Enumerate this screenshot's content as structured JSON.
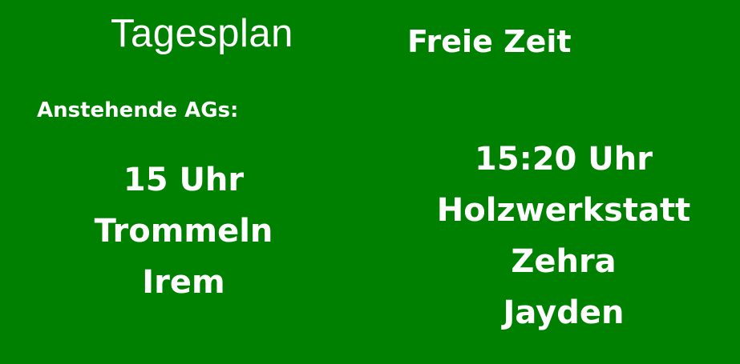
{
  "header": {
    "title": "Tagesplan",
    "status": "Freie Zeit"
  },
  "upcoming": {
    "label": "Anstehende AGs:"
  },
  "entries": [
    {
      "lines": [
        "15 Uhr",
        "Trommeln",
        "Irem"
      ]
    },
    {
      "lines": [
        "15:20 Uhr",
        "Holzwerkstatt",
        "Zehra",
        "Jayden"
      ]
    }
  ],
  "colors": {
    "background": "#008000",
    "text": "#ffffff"
  }
}
